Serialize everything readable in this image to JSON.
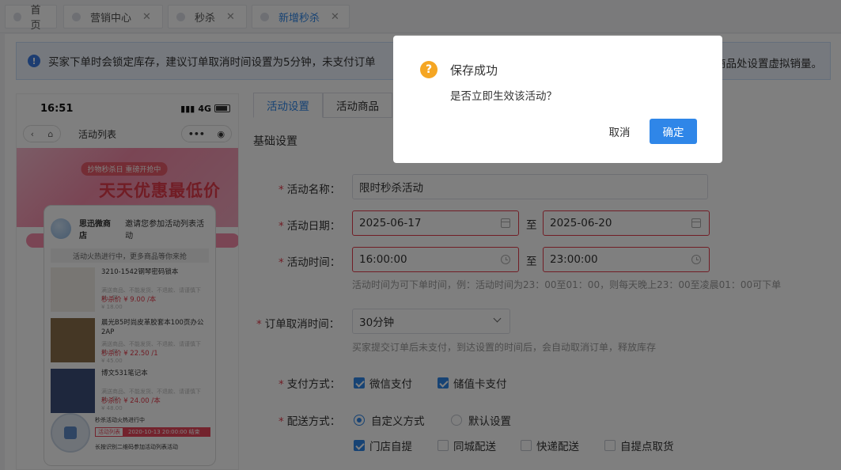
{
  "tabs": [
    {
      "label": "首页",
      "closable": false,
      "active": false
    },
    {
      "label": "营销中心",
      "closable": true,
      "active": false
    },
    {
      "label": "秒杀",
      "closable": true,
      "active": false
    },
    {
      "label": "新增秒杀",
      "closable": true,
      "active": true
    }
  ],
  "notice": {
    "text": "买家下单时会锁定库存，建议订单取消时间设置为5分钟，未支付订单",
    "tail": "商品处设置虚拟销量。"
  },
  "phone": {
    "time": "16:51",
    "network": "4G",
    "nav_title": "活动列表",
    "banner_sub": "抄物秒杀日 重磅开抢中",
    "banner_big": "天天优惠最低价",
    "poster": {
      "shop": "思迅微商店",
      "invite": "邀请您参加活动列表活动",
      "banner": "活动火热进行中，更多商品等你来抢",
      "products": [
        {
          "name": "3210-1542钢琴密码锁本",
          "desc": "满送商品、不能发货、不退款、请谨慎下单、等",
          "price": "秒杀价 ¥ 9.00 /本",
          "orig": "¥ 18.00"
        },
        {
          "name": "晨光B5时尚皮革胶套本100页办公2AP",
          "desc": "满送商品、不能发货、不退款、请谨慎下单、等",
          "price": "秒杀价 ¥ 22.50 /1",
          "orig": "¥ 45.00"
        },
        {
          "name": "博文531笔记本",
          "desc": "满送商品、不能发货、不退款、请谨慎下单、等",
          "price": "秒杀价 ¥ 24.00 /本",
          "orig": "¥ 48.00"
        }
      ],
      "foot_title": "秒杀活动火热进行中",
      "foot_tag": "活动列表",
      "foot_time": "2020-10-13 20:00:00 结束",
      "foot_hint": "长按识别二维码参加活动列表活动"
    }
  },
  "form": {
    "tabs": [
      "活动设置",
      "活动商品"
    ],
    "section": "基础设置",
    "name_label": "活动名称：",
    "name_value": "限时秒杀活动",
    "date_label": "活动日期：",
    "date_start": "2025-06-17",
    "date_end": "2025-06-20",
    "time_label": "活动时间：",
    "time_start": "16:00:00",
    "time_end": "23:00:00",
    "to": "至",
    "time_hint": "活动时间为可下单时间，例：活动时间为23：00至01：00，则每天晚上23：00至凌晨01：00可下单",
    "cancel_label": "订单取消时间：",
    "cancel_value": "30分钟",
    "cancel_hint": "买家提交订单后未支付，到达设置的时间后，会自动取消订单，释放库存",
    "pay_label": "支付方式：",
    "pay_options": [
      {
        "label": "微信支付",
        "checked": true
      },
      {
        "label": "储值卡支付",
        "checked": true
      }
    ],
    "delivery_label": "配送方式：",
    "delivery_radios": [
      {
        "label": "自定义方式",
        "checked": true
      },
      {
        "label": "默认设置",
        "checked": false
      }
    ],
    "delivery_options": [
      {
        "label": "门店自提",
        "checked": true
      },
      {
        "label": "同城配送",
        "checked": false
      },
      {
        "label": "快递配送",
        "checked": false
      },
      {
        "label": "自提点取货",
        "checked": false
      }
    ]
  },
  "modal": {
    "icon": "question-icon",
    "title": "保存成功",
    "message": "是否立即生效该活动？",
    "cancel": "取消",
    "confirm": "确定"
  }
}
